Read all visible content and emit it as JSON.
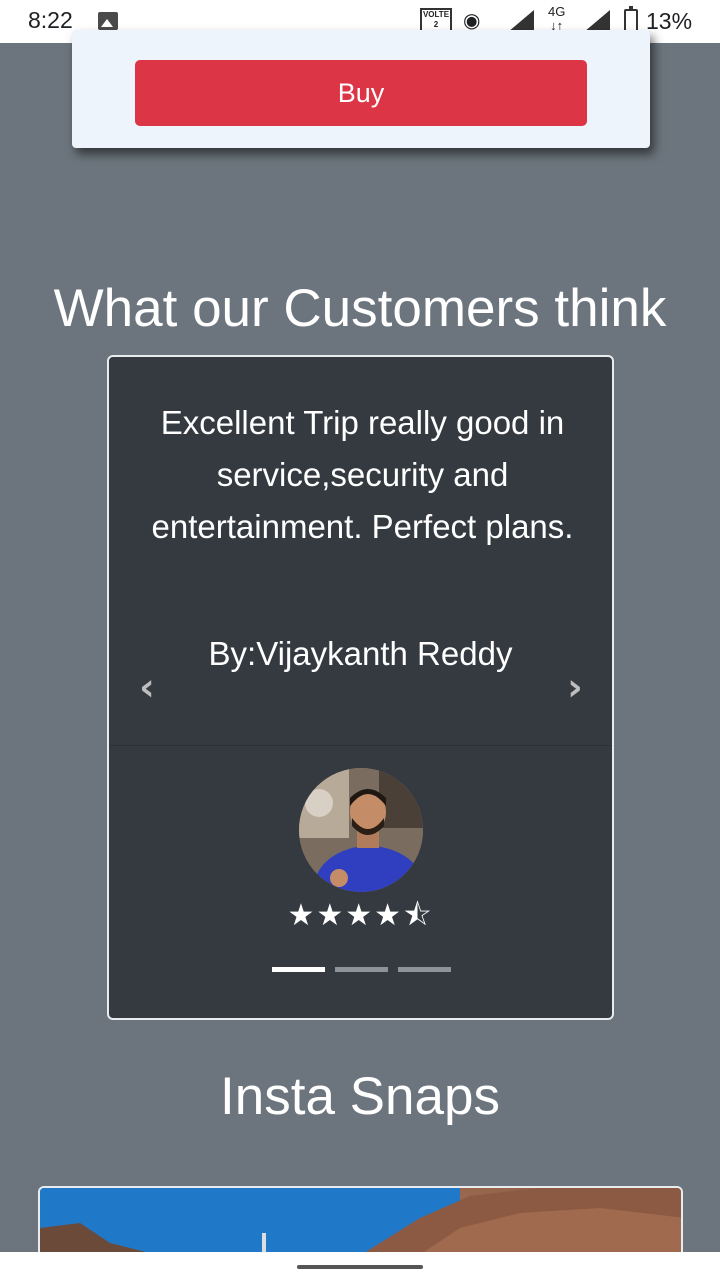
{
  "status_bar": {
    "time": "8:22",
    "volte_label": "VOLTE",
    "volte_sim": "2",
    "network_label": "4G",
    "battery_percent": "13%"
  },
  "buy_card": {
    "buy_label": "Buy",
    "button_color": "#dc3545"
  },
  "testimonials": {
    "title": "What our Customers think",
    "quote": "Excellent Trip really good in service,security and entertainment. Perfect plans.",
    "author": "By:Vijaykanth Reddy",
    "rating": 4.5,
    "rating_max": 5,
    "stars_display": "★★★★⯪",
    "prev_icon": "‹",
    "next_icon": "›",
    "slide_count": 3,
    "active_slide": 1
  },
  "insta": {
    "title": "Insta Snaps"
  },
  "colors": {
    "page_bg": "#6c757d",
    "card_bg": "#343a40",
    "accent": "#dc3545"
  }
}
